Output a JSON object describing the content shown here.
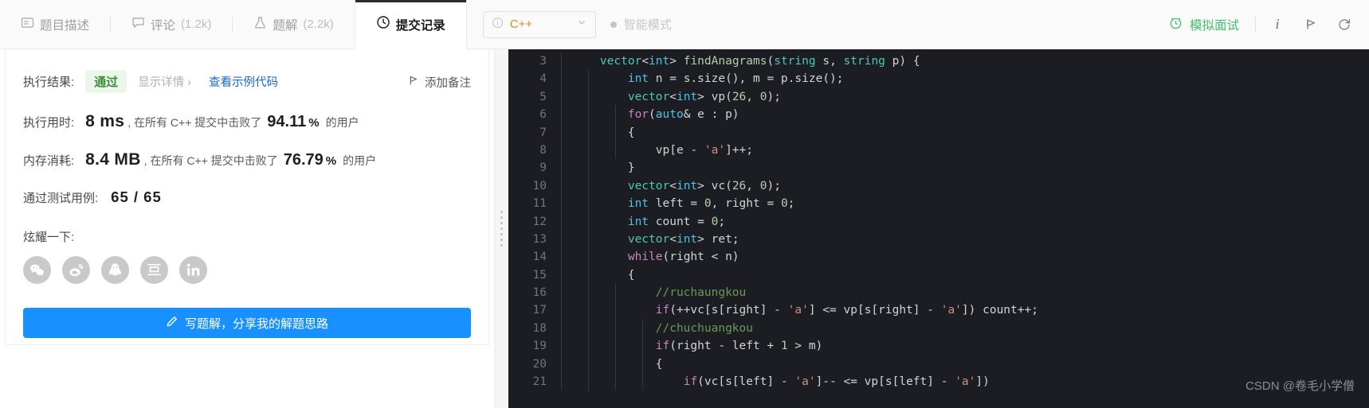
{
  "header": {
    "tabs": [
      {
        "label": "题目描述",
        "count": "",
        "icon": "description-icon",
        "active": false
      },
      {
        "label": "评论",
        "count": "(1.2k)",
        "icon": "comment-icon",
        "active": false
      },
      {
        "label": "题解",
        "count": "(2.2k)",
        "icon": "flask-icon",
        "active": false
      },
      {
        "label": "提交记录",
        "count": "",
        "icon": "clock-icon",
        "active": true
      }
    ],
    "language_select": {
      "value": "C++",
      "icon": "info-circle-icon",
      "caret": "chevron-down-icon"
    },
    "smart_mode": {
      "label": "智能模式",
      "enabled": false
    },
    "mock_interview": {
      "label": "模拟面试",
      "icon": "alarm-clock-icon",
      "color": "#3ec26b"
    },
    "info_icon": "i",
    "run_icon": "play-flag-icon",
    "refresh_icon": "refresh-icon"
  },
  "result": {
    "status_label": "执行结果:",
    "status_value": "通过",
    "show_detail": "显示详情 ›",
    "view_sample_code": "查看示例代码",
    "add_note": "添加备注",
    "runtime": {
      "label": "执行用时:",
      "value": "8 ms",
      "text_before_pct": ", 在所有 C++ 提交中击败了",
      "percent": "94.11",
      "percent_symbol": "%",
      "text_after_pct": "的用户"
    },
    "memory": {
      "label": "内存消耗:",
      "value": "8.4 MB",
      "text_before_pct": ", 在所有 C++ 提交中击败了",
      "percent": "76.79",
      "percent_symbol": "%",
      "text_after_pct": "的用户"
    },
    "testcases": {
      "label": "通过测试用例:",
      "value": "65 / 65"
    },
    "share": {
      "label": "炫耀一下:",
      "items": [
        {
          "name": "wechat-share-icon"
        },
        {
          "name": "weibo-share-icon"
        },
        {
          "name": "qq-share-icon"
        },
        {
          "name": "douban-share-icon"
        },
        {
          "name": "linkedin-share-icon"
        }
      ]
    },
    "write_solution_button": {
      "label": "写题解，分享我的解题思路",
      "icon": "pencil-icon",
      "color": "#1890ff"
    }
  },
  "editor": {
    "first_line_number": 3,
    "line_numbers": [
      3,
      4,
      5,
      6,
      7,
      8,
      9,
      10,
      11,
      12,
      13,
      14,
      15,
      16,
      17,
      18,
      19,
      20,
      21
    ],
    "lines": [
      "    vector<int> findAnagrams(string s, string p) {",
      "        int n = s.size(), m = p.size();",
      "        vector<int> vp(26, 0);",
      "        for(auto& e : p)",
      "        {",
      "            vp[e - 'a']++;",
      "        }",
      "        vector<int> vc(26, 0);",
      "        int left = 0, right = 0;",
      "        int count = 0;",
      "        vector<int> ret;",
      "        while(right < n)",
      "        {",
      "            //ruchaungkou",
      "            if(++vc[s[right] - 'a'] <= vp[s[right] - 'a']) count++;",
      "            //chuchuangkou",
      "            if(right - left + 1 > m)",
      "            {",
      "                if(vc[s[left] - 'a']-- <= vp[s[left] - 'a'])"
    ]
  },
  "watermark": "CSDN @卷毛小学僧"
}
